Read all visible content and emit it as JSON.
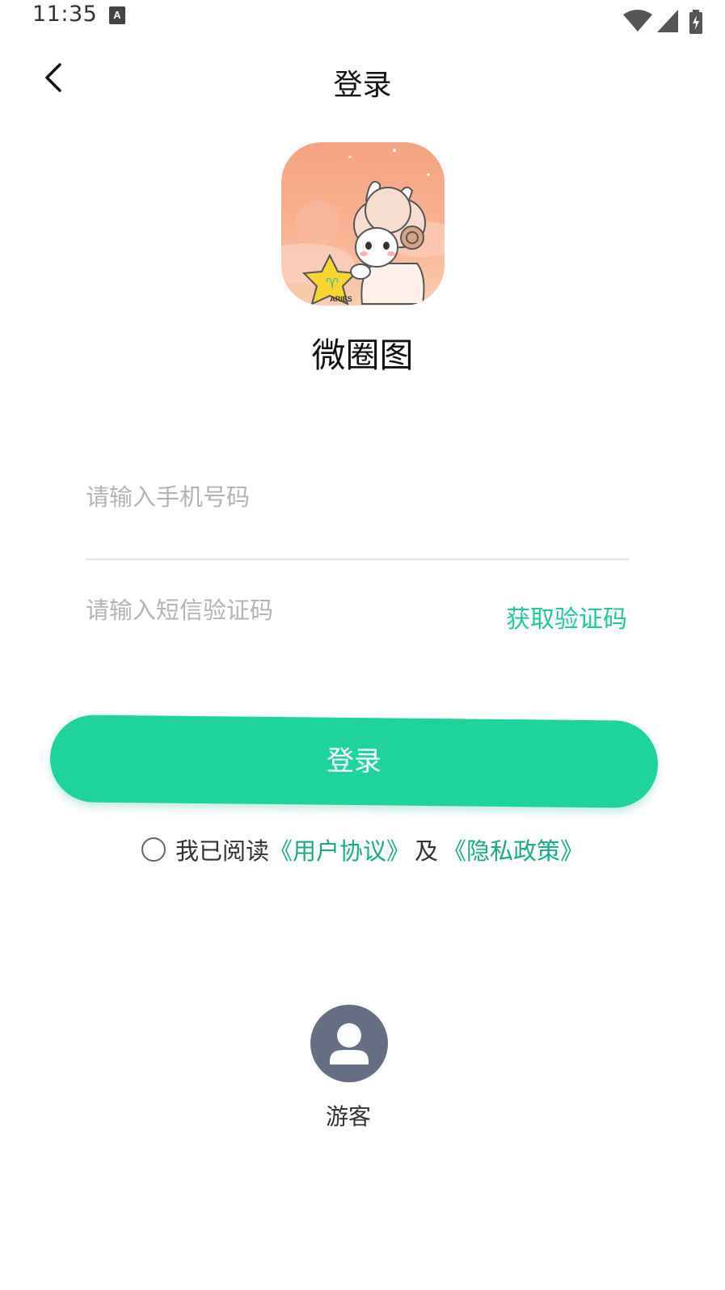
{
  "status_bar": {
    "time": "11:35",
    "icons": [
      "a-icon",
      "wifi-icon",
      "cell-signal-icon",
      "battery-charging-icon"
    ]
  },
  "header": {
    "title": "登录",
    "back_icon": "chevron-left-icon"
  },
  "app": {
    "name": "微圈图",
    "logo_badge_text": "ARIES"
  },
  "form": {
    "phone_placeholder": "请输入手机号码",
    "code_placeholder": "请输入短信验证码",
    "get_code_label": "获取验证码",
    "login_label": "登录"
  },
  "agreement": {
    "prefix": "我已阅读",
    "user_agreement": "《用户协议》",
    "and": "及",
    "privacy_policy": "《隐私政策》",
    "checked": false
  },
  "guest": {
    "label": "游客"
  },
  "colors": {
    "accent": "#1ed49c",
    "link": "#1aaa86",
    "guest_avatar": "#666e83"
  }
}
